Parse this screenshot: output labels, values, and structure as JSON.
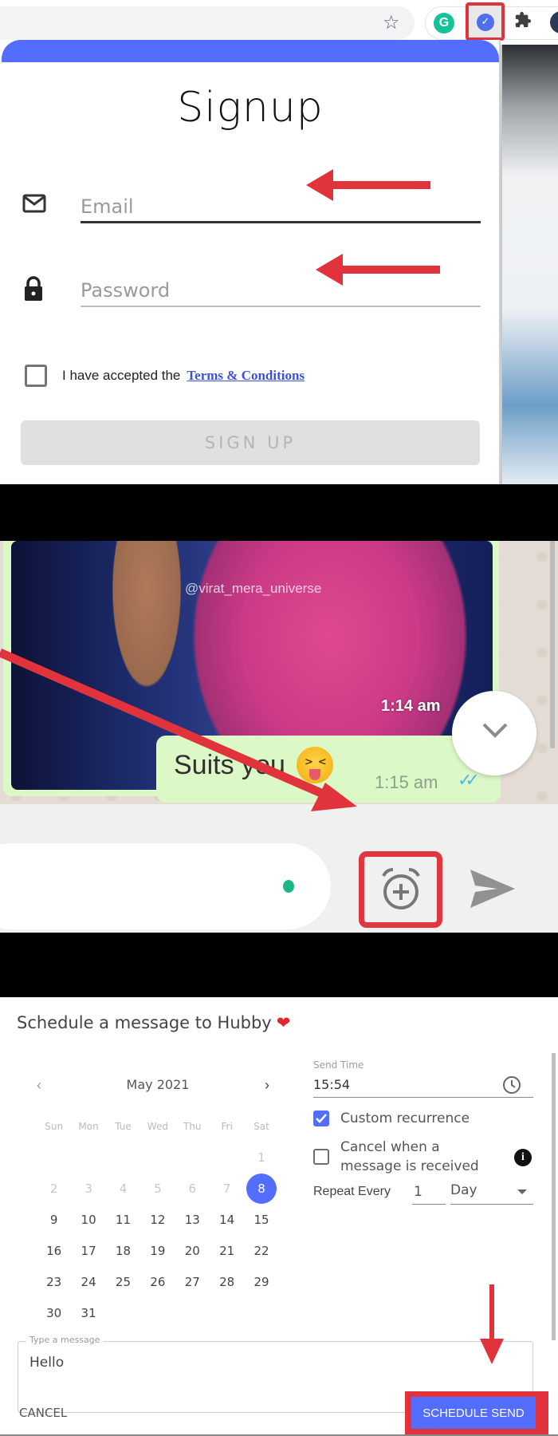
{
  "browser": {
    "icons": [
      "bookmark-star-icon",
      "grammarly-extension-icon",
      "scheduler-extension-icon",
      "extensions-puzzle-icon",
      "profile-avatar"
    ],
    "grammarly_letter": "G",
    "scheduler_glyph": "✓",
    "star_glyph": "☆",
    "puzzle_glyph": "🧩"
  },
  "signup": {
    "title": "Signup",
    "email_placeholder": "Email",
    "password_placeholder": "Password",
    "terms_prefix": "I have accepted the",
    "terms_link": "Terms & Conditions",
    "terms_checked": false,
    "signup_button": "SIGN UP",
    "accent_color": "#536dfe"
  },
  "chat": {
    "image_watermark": "@virat_mera_universe",
    "image_time": "1:14 am",
    "message_text": "Suits you",
    "message_emoji": "squinting-face-with-tongue",
    "message_time": "1:15 am",
    "message_status": "read",
    "ticks_glyph": "✓✓",
    "compose_value": "",
    "buttons": [
      "scroll-down",
      "schedule-message",
      "send"
    ]
  },
  "schedule_dialog": {
    "title": "Schedule a message to Hubby",
    "title_emoji": "❤",
    "calendar": {
      "month_label": "May 2021",
      "prev_glyph": "‹",
      "next_glyph": "›",
      "weekdays": [
        "Sun",
        "Mon",
        "Tue",
        "Wed",
        "Thu",
        "Fri",
        "Sat"
      ],
      "selected_day": 8,
      "first_weekday_index": 6,
      "days_in_month": 31,
      "disabled_days": [
        1,
        2,
        3,
        4,
        5,
        6,
        7
      ]
    },
    "send_time_label": "Send Time",
    "send_time_value": "15:54",
    "custom_recurrence_label": "Custom recurrence",
    "custom_recurrence_checked": true,
    "cancel_on_reply_label": "Cancel when a message is received",
    "cancel_on_reply_checked": false,
    "info_glyph": "i",
    "repeat_label": "Repeat Every",
    "repeat_value": "1",
    "repeat_unit": "Day",
    "message_label": "Type a message",
    "message_value": "Hello",
    "cancel_button": "CANCEL",
    "schedule_button": "SCHEDULE SEND"
  },
  "annotation_color": "#e0333c"
}
